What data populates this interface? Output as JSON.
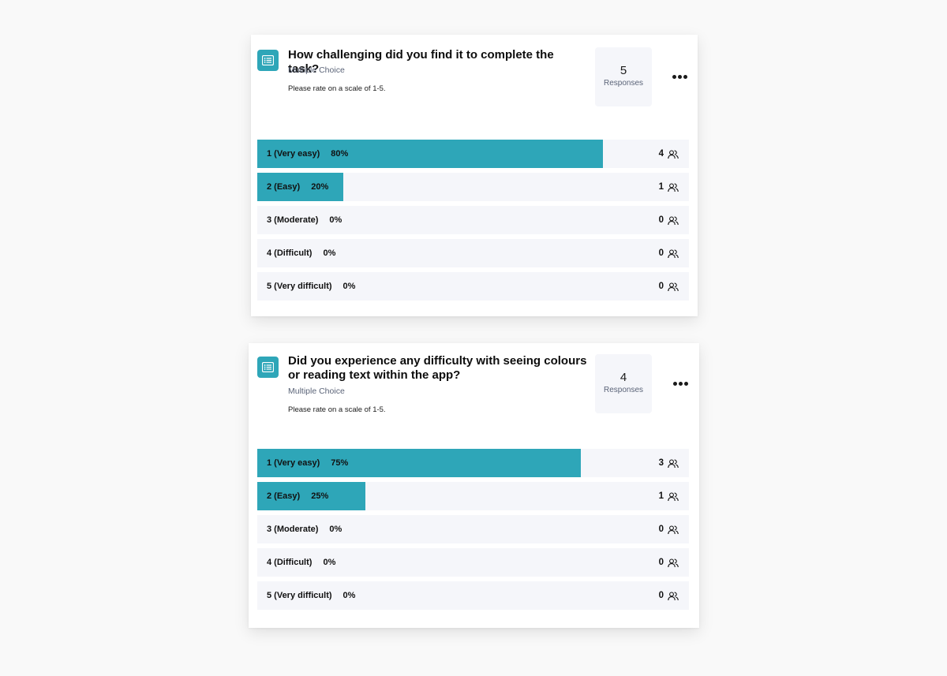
{
  "colors": {
    "accent": "#2ea6b8",
    "row_bg": "#f5f6fa",
    "text": "#111111",
    "muted": "#5b6478"
  },
  "questions": [
    {
      "icon": "list-icon",
      "title": "How challenging did you find it to complete the task?",
      "type": "Multiple Choice",
      "description": "Please rate on a scale of 1-5.",
      "responses_count": "5",
      "responses_label": "Responses",
      "options": [
        {
          "label": "1 (Very easy)",
          "percent_text": "80%",
          "percent": 80,
          "count": "4"
        },
        {
          "label": "2 (Easy)",
          "percent_text": "20%",
          "percent": 20,
          "count": "1"
        },
        {
          "label": "3 (Moderate)",
          "percent_text": "0%",
          "percent": 0,
          "count": "0"
        },
        {
          "label": "4 (Difficult)",
          "percent_text": "0%",
          "percent": 0,
          "count": "0"
        },
        {
          "label": "5 (Very difficult)",
          "percent_text": "0%",
          "percent": 0,
          "count": "0"
        }
      ]
    },
    {
      "icon": "list-icon",
      "title": "Did you experience any difficulty with seeing colours or reading text within the app?",
      "type": "Multiple Choice",
      "description": "Please rate on a scale of 1-5.",
      "responses_count": "4",
      "responses_label": "Responses",
      "options": [
        {
          "label": "1 (Very easy)",
          "percent_text": "75%",
          "percent": 75,
          "count": "3"
        },
        {
          "label": "2 (Easy)",
          "percent_text": "25%",
          "percent": 25,
          "count": "1"
        },
        {
          "label": "3 (Moderate)",
          "percent_text": "0%",
          "percent": 0,
          "count": "0"
        },
        {
          "label": "4 (Difficult)",
          "percent_text": "0%",
          "percent": 0,
          "count": "0"
        },
        {
          "label": "5 (Very difficult)",
          "percent_text": "0%",
          "percent": 0,
          "count": "0"
        }
      ]
    }
  ]
}
